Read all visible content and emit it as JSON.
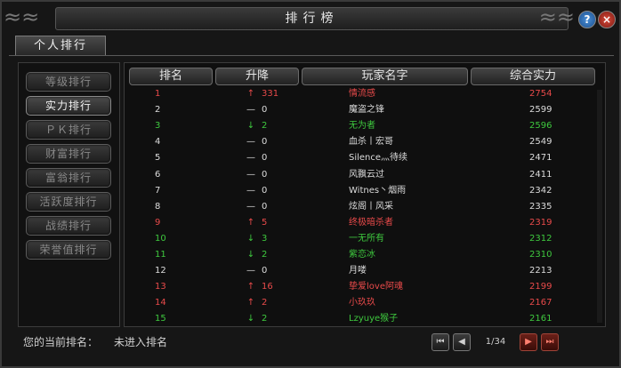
{
  "window": {
    "title": "排行榜",
    "help_label": "?",
    "close_label": "×",
    "corner_left": "≈≈",
    "corner_right": "≈≈"
  },
  "tabs": [
    {
      "label": "个人排行",
      "active": true
    }
  ],
  "sidebar": {
    "items": [
      {
        "label": "等级排行",
        "active": false
      },
      {
        "label": "实力排行",
        "active": true
      },
      {
        "label": "ＰＫ排行",
        "active": false
      },
      {
        "label": "财富排行",
        "active": false
      },
      {
        "label": "富翁排行",
        "active": false
      },
      {
        "label": "活跃度排行",
        "active": false
      },
      {
        "label": "战绩排行",
        "active": false
      },
      {
        "label": "荣誉值排行",
        "active": false
      }
    ]
  },
  "table": {
    "headers": {
      "rank": "排名",
      "change": "升降",
      "name": "玩家名字",
      "power": "综合实力"
    },
    "rows": [
      {
        "rank": "1",
        "arrow": "↑",
        "change": "331",
        "name": "情流感",
        "power": "2754",
        "color": "red"
      },
      {
        "rank": "2",
        "arrow": "—",
        "change": "0",
        "name": "魔盗之锋",
        "power": "2599",
        "color": "white"
      },
      {
        "rank": "3",
        "arrow": "↓",
        "change": "2",
        "name": "无为者",
        "power": "2596",
        "color": "green"
      },
      {
        "rank": "4",
        "arrow": "—",
        "change": "0",
        "name": "血杀丨宏哥",
        "power": "2549",
        "color": "white"
      },
      {
        "rank": "5",
        "arrow": "—",
        "change": "0",
        "name": "Silence灬待续",
        "power": "2471",
        "color": "white"
      },
      {
        "rank": "6",
        "arrow": "—",
        "change": "0",
        "name": "风飘云过",
        "power": "2411",
        "color": "white"
      },
      {
        "rank": "7",
        "arrow": "—",
        "change": "0",
        "name": "Witnes丶烟雨",
        "power": "2342",
        "color": "white"
      },
      {
        "rank": "8",
        "arrow": "—",
        "change": "0",
        "name": "炫阁丨风采",
        "power": "2335",
        "color": "white"
      },
      {
        "rank": "9",
        "arrow": "↑",
        "change": "5",
        "name": "终极暗杀者",
        "power": "2319",
        "color": "red"
      },
      {
        "rank": "10",
        "arrow": "↓",
        "change": "3",
        "name": "一无所有",
        "power": "2312",
        "color": "green"
      },
      {
        "rank": "11",
        "arrow": "↓",
        "change": "2",
        "name": "紫恋冰",
        "power": "2310",
        "color": "green"
      },
      {
        "rank": "12",
        "arrow": "—",
        "change": "0",
        "name": "月喽",
        "power": "2213",
        "color": "white"
      },
      {
        "rank": "13",
        "arrow": "↑",
        "change": "16",
        "name": "挚爱love阿魂",
        "power": "2199",
        "color": "red"
      },
      {
        "rank": "14",
        "arrow": "↑",
        "change": "2",
        "name": "小玖玖",
        "power": "2167",
        "color": "red"
      },
      {
        "rank": "15",
        "arrow": "↓",
        "change": "2",
        "name": "Lzyuye猴子",
        "power": "2161",
        "color": "green"
      }
    ]
  },
  "status": {
    "label": "您的当前排名：",
    "value": "未进入排名"
  },
  "pagination": {
    "page": "1/34",
    "first_label": "⏮",
    "prev_label": "◀",
    "next_label": "▶",
    "last_label": "⏭"
  },
  "colors": {
    "red": "#e84a4a",
    "green": "#3ec83e",
    "white": "#dcdcdc",
    "accent": "#c03020"
  }
}
